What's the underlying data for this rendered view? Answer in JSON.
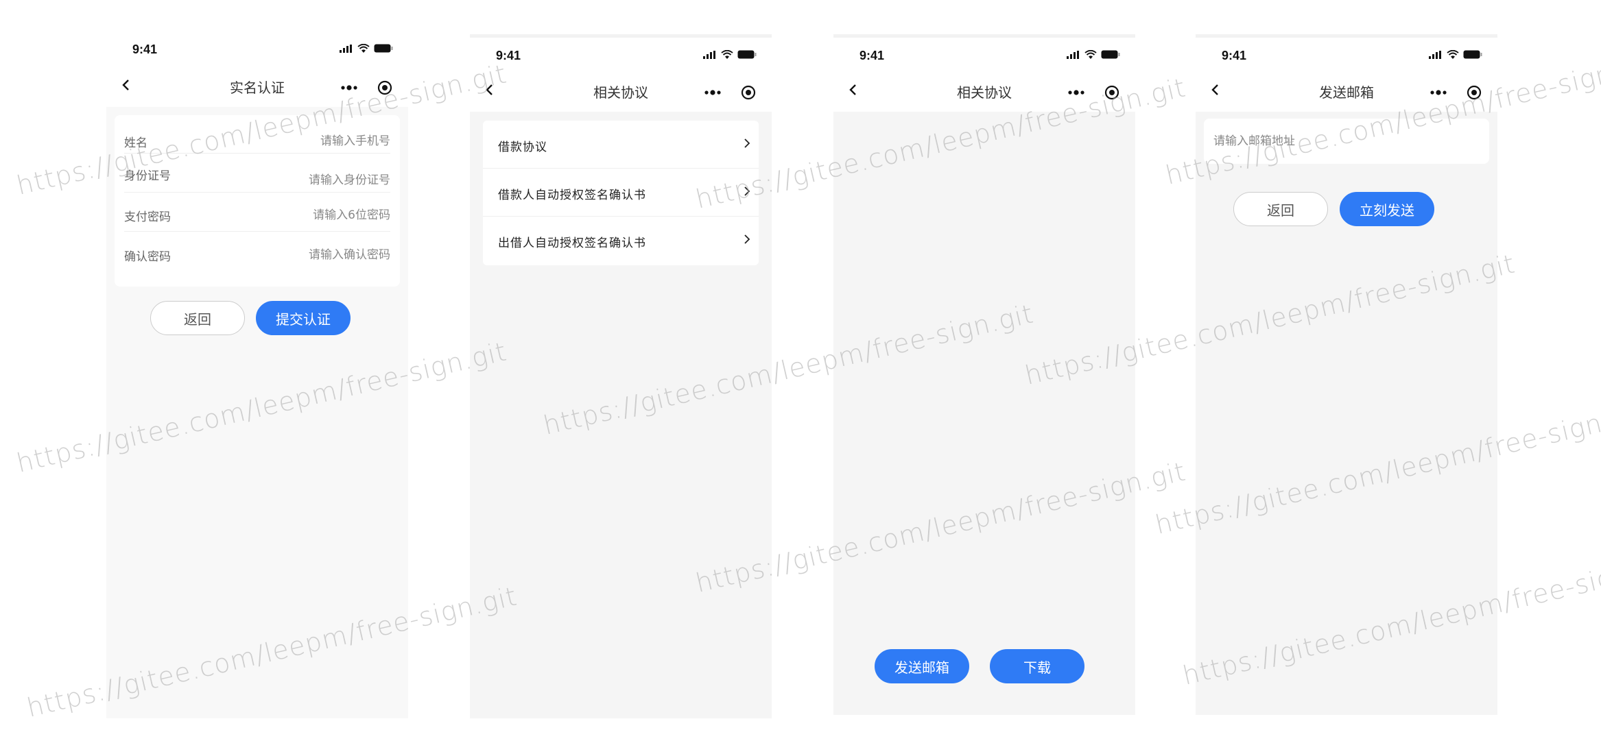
{
  "status_time": "9:41",
  "screens": [
    {
      "title": "实名认证",
      "fields": [
        {
          "label": "姓名",
          "placeholder": "请输入手机号"
        },
        {
          "label": "身份证号",
          "placeholder": "请输入身份证号"
        },
        {
          "label": "支付密码",
          "placeholder": "请输入6位密码"
        },
        {
          "label": "确认密码",
          "placeholder": "请输入确认密码"
        }
      ],
      "back_button": "返回",
      "submit_button": "提交认证"
    },
    {
      "title": "相关协议",
      "items": [
        {
          "label": "借款协议"
        },
        {
          "label": "借款人自动授权签名确认书"
        },
        {
          "label": "出借人自动授权签名确认书"
        }
      ]
    },
    {
      "title": "相关协议",
      "send_button": "发送邮箱",
      "download_button": "下载"
    },
    {
      "title": "发送邮箱",
      "email_placeholder": "请输入邮箱地址",
      "back_button": "返回",
      "send_now_button": "立刻发送"
    }
  ],
  "watermark": "https://gitee.com/leepm/free-sign.git",
  "colors": {
    "primary": "#2f7bf5",
    "background": "#f5f5f5"
  },
  "icons": [
    "back-icon",
    "more-icon",
    "close-target-icon",
    "signal-icon",
    "wifi-icon",
    "battery-icon",
    "chevron-right-icon"
  ]
}
